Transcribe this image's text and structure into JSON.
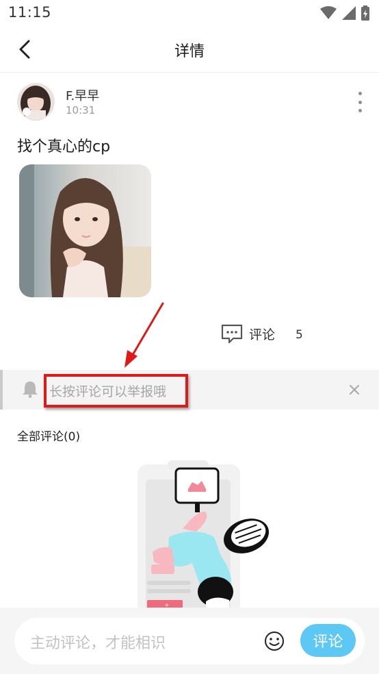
{
  "status_bar": {
    "time": "11:15"
  },
  "header": {
    "title": "详情"
  },
  "post": {
    "author": "F.早早",
    "time": "10:31",
    "text": "找个真心的cp",
    "comment_label": "评论",
    "comment_count": "5"
  },
  "tip": {
    "text": "长按评论可以举报哦"
  },
  "comments": {
    "title": "全部评论(0)"
  },
  "bottom": {
    "placeholder": "主动评论，才能相识",
    "submit_label": "评论"
  },
  "colors": {
    "accent": "#5ec8f5",
    "annotation": "#e01818"
  },
  "icons": [
    "back-arrow-icon",
    "more-vertical-icon",
    "comment-bubble-icon",
    "bell-icon",
    "close-icon",
    "smiley-icon",
    "wifi-icon",
    "signal-icon",
    "battery-icon"
  ]
}
